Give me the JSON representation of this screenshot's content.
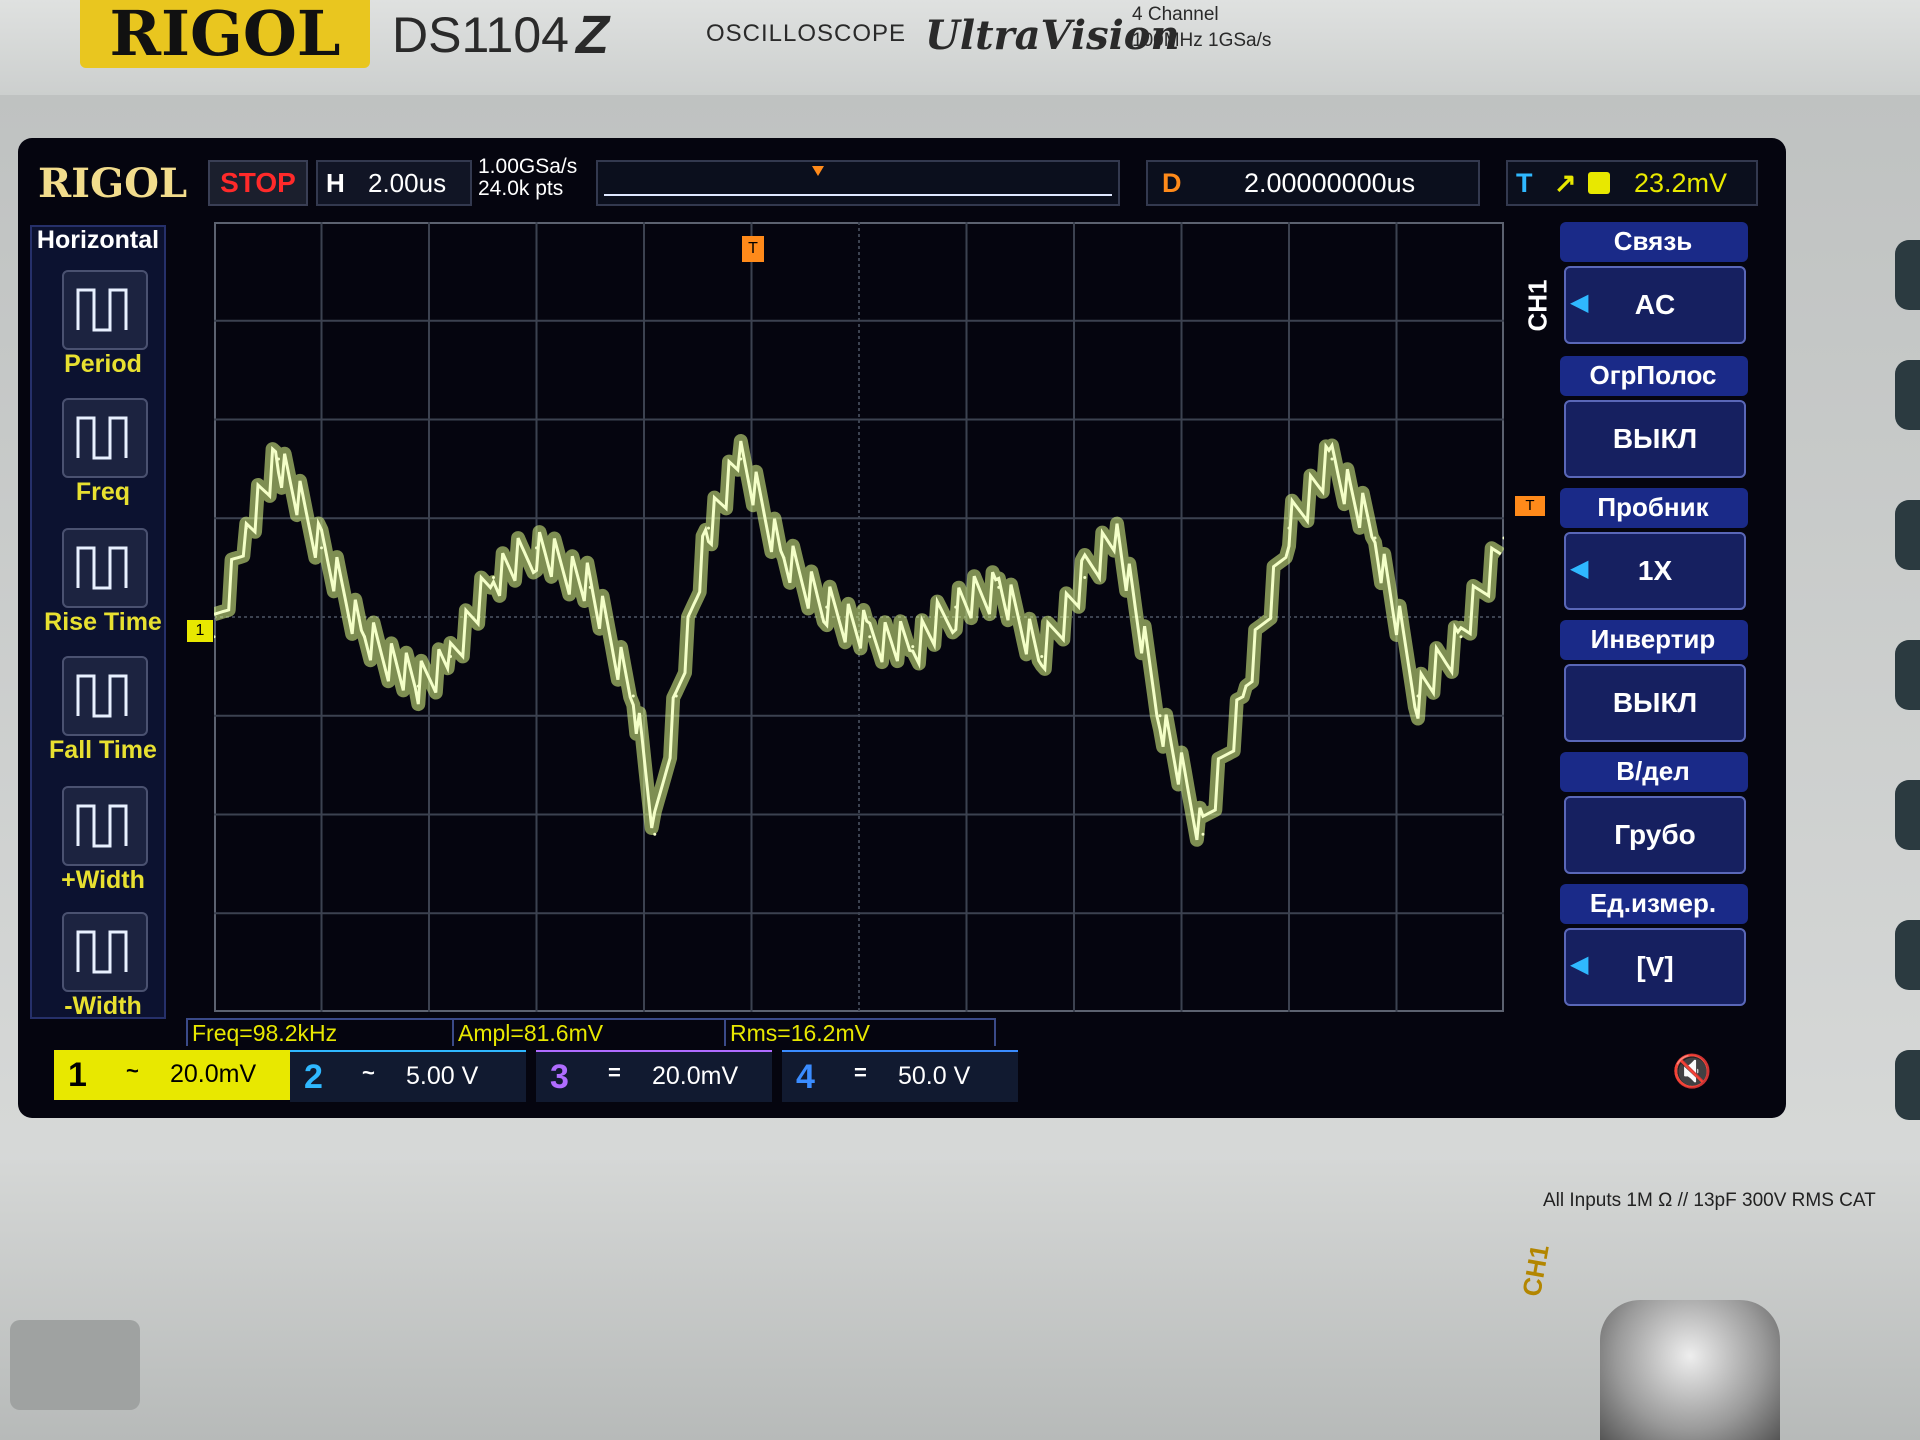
{
  "device": {
    "brand": "RIGOL",
    "model": "DS1104",
    "model_suffix": "Z",
    "category": "OSCILLOSCOPE",
    "series": "UltraVision",
    "spec_line1": "4 Channel",
    "spec_line2": "100MHz   1GSa/s",
    "input_rating": "All Inputs 1M Ω // 13pF 300V RMS   CAT",
    "jack_label": "CH1"
  },
  "status_bar": {
    "logo": "RIGOL",
    "run_state": "STOP",
    "horizontal_label": "H",
    "timebase": "2.00us",
    "sample_rate": "1.00GSa/s",
    "memory_depth": "24.0k pts",
    "delay_label": "D",
    "delay_value": "2.00000000us",
    "trigger_label": "T",
    "trigger_slope": "rising",
    "trigger_source": "1",
    "trigger_level": "23.2mV"
  },
  "left_menu": {
    "title": "Horizontal",
    "items": [
      {
        "label": "Period",
        "icon": "period-icon"
      },
      {
        "label": "Freq",
        "icon": "freq-icon"
      },
      {
        "label": "Rise Time",
        "icon": "rise-time-icon"
      },
      {
        "label": "Fall Time",
        "icon": "fall-time-icon"
      },
      {
        "label": "+Width",
        "icon": "pos-width-icon"
      },
      {
        "label": "-Width",
        "icon": "neg-width-icon"
      }
    ]
  },
  "right_menu": {
    "channel": "CH1",
    "items": [
      {
        "label": "Связь",
        "value": "AC"
      },
      {
        "label": "ОгрПолос",
        "value": "ВЫКЛ"
      },
      {
        "label": "Пробник",
        "value": "1X"
      },
      {
        "label": "Инвертир",
        "value": "ВЫКЛ"
      },
      {
        "label": "В/дел",
        "value": "Грубо"
      },
      {
        "label": "Ед.измер.",
        "value": "[V]"
      }
    ]
  },
  "measurements": {
    "freq": "Freq=98.2kHz",
    "ampl": "Ampl=81.6mV",
    "rms": "Rms=16.2mV"
  },
  "channels": [
    {
      "num": "1",
      "coupling": "~",
      "scale": "20.0mV",
      "color": "#e8e800"
    },
    {
      "num": "2",
      "coupling": "~",
      "scale": "5.00 V",
      "color": "#2fb8ff"
    },
    {
      "num": "3",
      "coupling": "=",
      "scale": "20.0mV",
      "color": "#b06cff"
    },
    {
      "num": "4",
      "coupling": "=",
      "scale": "50.0 V",
      "color": "#3a8cff"
    }
  ],
  "markers": {
    "ground_marker": "1",
    "trigger_marker": "T",
    "trigger_pos_marker": "T"
  },
  "colors": {
    "trace": "#e2ff8a",
    "screen_bg": "#05050f",
    "brand_yellow": "#e9c61f"
  },
  "chart_data": {
    "type": "line",
    "x_divisions": 12,
    "y_divisions": 8,
    "grid": true,
    "series": [
      {
        "name": "CH1",
        "x_div": [
          0,
          0.3,
          0.6,
          1.0,
          1.4,
          1.9,
          2.2,
          2.6,
          3.0,
          3.5,
          3.9,
          4.1,
          4.3,
          4.6,
          4.9,
          5.3,
          5.7,
          6.1,
          6.5,
          6.9,
          7.3,
          7.7,
          8.1,
          8.4,
          8.8,
          9.2,
          9.6,
          10.0,
          10.4,
          10.8,
          11.2,
          11.6,
          12.0
        ],
        "y_div": [
          -0.2,
          0.9,
          1.6,
          0.7,
          -0.2,
          -0.7,
          -0.4,
          0.4,
          0.7,
          0.3,
          -0.8,
          -2.2,
          -0.8,
          0.9,
          1.6,
          0.6,
          0.1,
          -0.2,
          -0.3,
          0.1,
          0.3,
          -0.4,
          0.4,
          0.9,
          -1.0,
          -2.2,
          -0.7,
          0.9,
          1.6,
          0.8,
          -0.8,
          -0.2,
          0.8
        ]
      }
    ]
  }
}
